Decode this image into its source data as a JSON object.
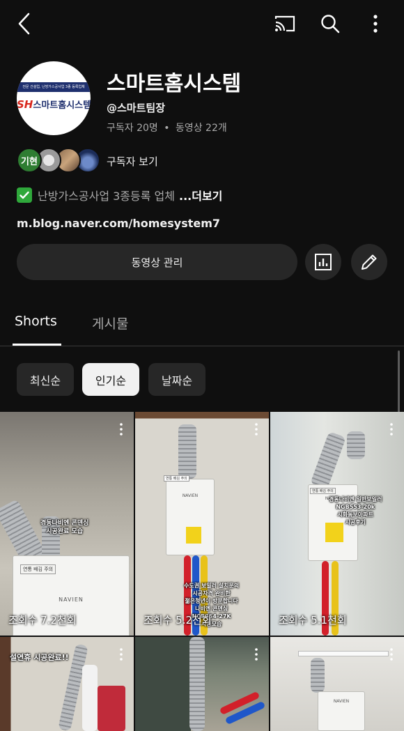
{
  "icons": {
    "back": "back-arrow-icon",
    "cast": "cast-icon",
    "search": "search-icon",
    "more": "more-vert-icon",
    "stats": "bar-chart-icon",
    "edit": "pencil-icon",
    "check": "check-mark-icon"
  },
  "channel": {
    "avatar_strip": "전문 건설업, 난방가스공사업 3종 등록업체",
    "avatar_logo_sh": "SH",
    "avatar_logo_text": "스마트홈시스템",
    "title": "스마트홈시스템",
    "handle": "@스마트팀장",
    "subscribers": "구독자 20명",
    "separator": "•",
    "videos": "동영상 22개",
    "subscriber_avatar_1": "기현",
    "subscribers_link": "구독자 보기",
    "description": "난방가스공사업 3종등록 업체",
    "more": "...더보기",
    "link": "m.blog.naver.com/homesystem7",
    "manage_button": "동영상 관리"
  },
  "tabs": {
    "shorts": "Shorts",
    "posts": "게시물"
  },
  "chips": {
    "latest": "최신순",
    "popular": "인기순",
    "date": "날짜순"
  },
  "shorts": [
    {
      "caption": "경동나비엔 콘덴싱\n시공완료 모습",
      "views": "조회수 7.2천회",
      "sticker": "연통 배김 주의",
      "brand": "NAVIEN"
    },
    {
      "caption": "수도권 보일러 설치문의\n시공자격 완비한\n젊은청년이 방문합니다\n나비엔 콘덴싱\nNCB354-27K\n시공모습",
      "views": "조회수 5.2천회",
      "sticker": "연통 배김 주의",
      "brand": "NAVIEN"
    },
    {
      "caption": "경동나비엔 일반보일러\nNGB553-20k\n시화동보아파트\n시공후기",
      "views": "조회수 5.1천회",
      "sticker": "연통 배김 주의",
      "brand": "NAVIEN"
    },
    {
      "caption": "설연휴 시공완료!!",
      "views": "",
      "brand": ""
    },
    {
      "caption": "",
      "views": "",
      "brand": ""
    },
    {
      "caption": "",
      "views": "",
      "brand": "NAVIEN"
    }
  ]
}
